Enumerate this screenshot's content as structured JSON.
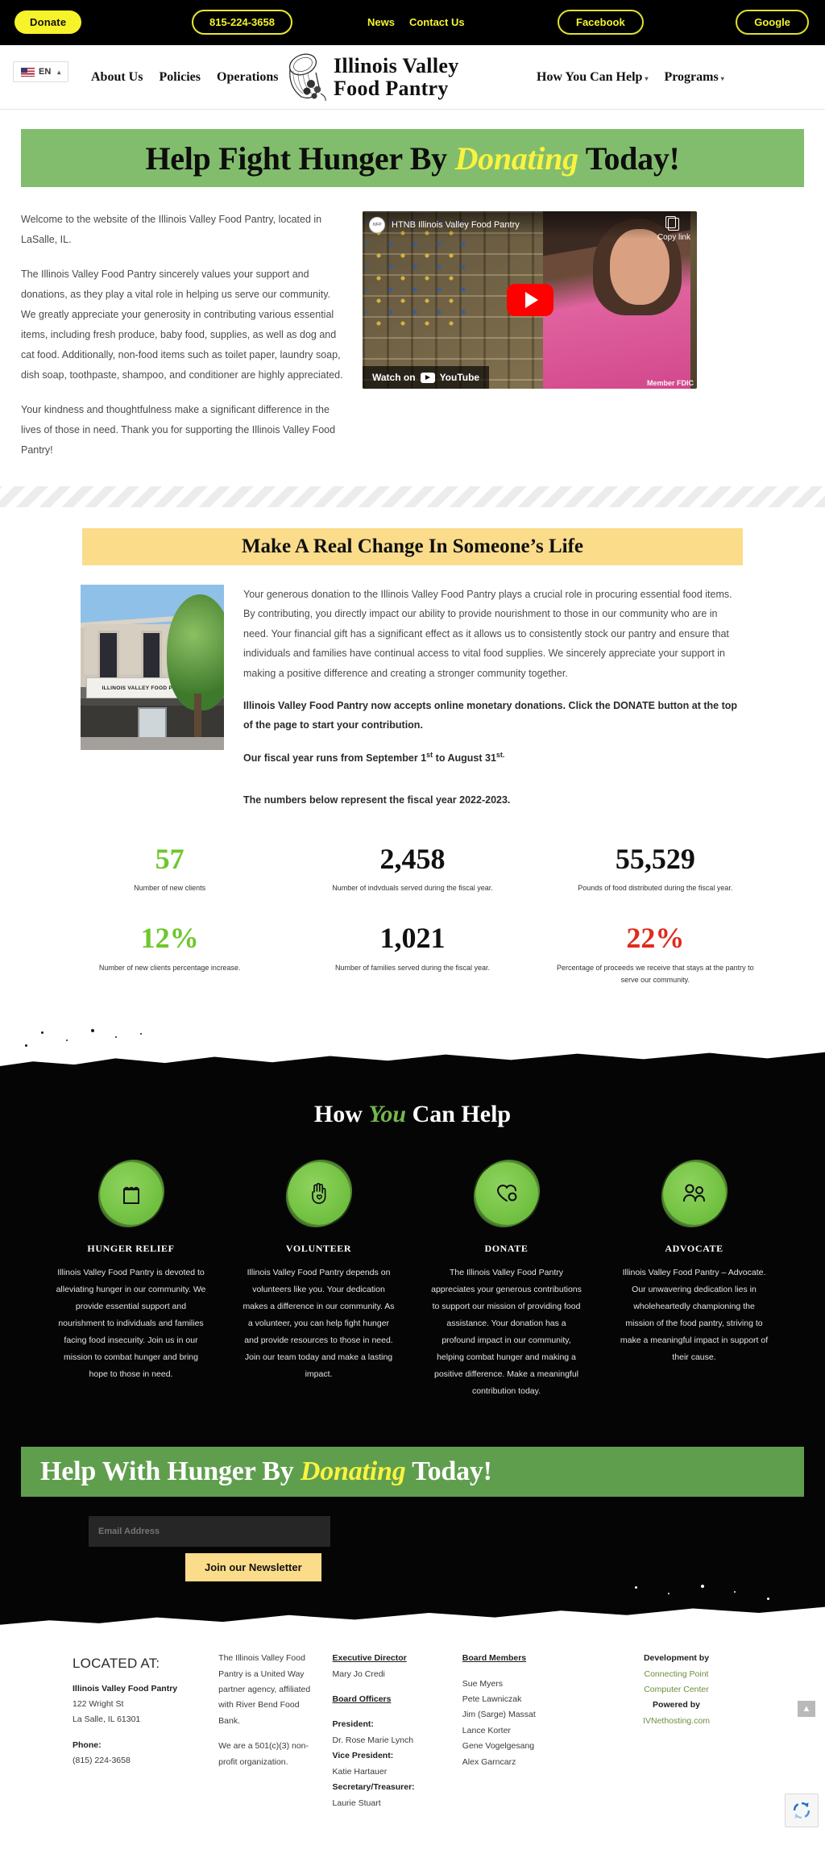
{
  "topbar": {
    "donate_label": "Donate",
    "phone_label": "815-224-3658",
    "news_label": "News",
    "contact_label": "Contact Us",
    "facebook_label": "Facebook",
    "google_label": "Google"
  },
  "nav": {
    "language": "EN",
    "left_items": [
      {
        "label": "About Us"
      },
      {
        "label": "Policies"
      },
      {
        "label": "Operations"
      }
    ],
    "right_items": [
      {
        "label": "How You Can Help",
        "caret": "▾"
      },
      {
        "label": "Programs",
        "caret": "▾"
      }
    ],
    "logo_line1": "Illinois Valley",
    "logo_line2": "Food Pantry"
  },
  "hero": {
    "part1": "Help Fight Hunger ",
    "part2": "By ",
    "accent": "Donating",
    "part3": " Today!"
  },
  "intro": {
    "p1": "Welcome to the website of the Illinois Valley Food Pantry, located in LaSalle, IL.",
    "p2": "The Illinois Valley Food Pantry sincerely values your support and donations, as they play a vital role in helping us serve our community. We greatly appreciate your generosity in contributing various essential items, including fresh produce, baby food, supplies, as well as dog and cat food. Additionally, non-food items such as toilet paper, laundry soap, dish soap, toothpaste, shampoo, and conditioner are highly appreciated.",
    "p3": "Your kindness and thoughtfulness make a significant difference in the lives of those in need. Thank you for supporting the Illinois Valley Food Pantry!"
  },
  "video": {
    "title": "HTNB Illinois Valley Food Pantry",
    "copy_link": "Copy link",
    "watch_on": "Watch on",
    "platform": "YouTube",
    "channel_badge": "IVFP",
    "fdic": "Member FDIC"
  },
  "change": {
    "heading": "Make A Real Change In Someone’s Life",
    "image_sign": "ILLINOIS VALLEY FOOD PANTRY",
    "p1": "Your generous donation to the Illinois Valley Food Pantry plays a crucial role in procuring essential food items. By contributing, you directly impact our ability to provide nourishment to those in our community who are in need. Your financial gift has a significant effect as it allows us to consistently stock our pantry and ensure that individuals and families have continual access to vital food supplies. We sincerely appreciate your support in making a positive difference and creating a stronger community together.",
    "p2": "Illinois Valley Food Pantry now accepts online monetary donations.  Click the DONATE button at the top of the page to start your contribution.",
    "fiscal_a": "Our fiscal year runs from September 1",
    "fiscal_sup1": "st",
    "fiscal_b": " to August 31",
    "fiscal_sup2": "st.",
    "p4": "The numbers below represent the fiscal year 2022-2023."
  },
  "stats": [
    {
      "value": "57",
      "color": "green",
      "caption": "Number of new clients"
    },
    {
      "value": "2,458",
      "color": "black",
      "caption": "Number of indvduals served during the fiscal year."
    },
    {
      "value": "55,529",
      "color": "black",
      "caption": "Pounds of food distributed during the fiscal year."
    },
    {
      "value": "12%",
      "color": "green",
      "caption": "Number of new clients percentage increase."
    },
    {
      "value": "1,021",
      "color": "black",
      "caption": "Number of families served during the fiscal year."
    },
    {
      "value": "22%",
      "color": "red",
      "caption": "Percentage of proceeds we receive that stays at the pantry to serve our community."
    }
  ],
  "help": {
    "title_a": "How ",
    "title_em": "You",
    "title_b": " Can Help",
    "cards": [
      {
        "icon": "grocery-bag-icon",
        "title": "HUNGER RELIEF",
        "text": "Illinois Valley Food Pantry is devoted to alleviating hunger in our community. We provide essential support and nourishment to individuals and families facing food insecurity. Join us in our mission to combat hunger and bring hope to those in need."
      },
      {
        "icon": "helping-hand-icon",
        "title": "VOLUNTEER",
        "text": "Illinois Valley Food Pantry depends on volunteers like you. Your dedication makes a difference in our community. As a volunteer, you can help fight hunger and provide resources to those in need. Join our team today and make a lasting impact."
      },
      {
        "icon": "heart-icon",
        "title": "DONATE",
        "text": "The Illinois Valley Food Pantry appreciates your generous contributions to support our mission of providing food assistance. Your donation has a profound impact in our community, helping combat hunger and making a positive difference.  Make a meaningful contribution today."
      },
      {
        "icon": "people-icon",
        "title": "ADVOCATE",
        "text": "Illinois Valley Food Pantry – Advocate. Our unwavering dedication lies in wholeheartedly championing the mission of the food pantry, striving to make a meaningful impact in support of their cause."
      }
    ]
  },
  "banner2": {
    "part1": "Help With Hunger ",
    "part2": "By ",
    "accent": "Donating",
    "part3": " Today!"
  },
  "newsletter": {
    "email_placeholder": "Email Address",
    "button_label": "Join our Newsletter"
  },
  "footer": {
    "col1": {
      "located_at": "LOCATED AT:",
      "org": "Illinois Valley Food Pantry",
      "street": "122 Wright St",
      "city": "La Salle, IL 61301",
      "phone_label": "Phone:",
      "phone": "(815) 224-3658"
    },
    "col2": {
      "p1": "The Illinois Valley Food Pantry is a United Way partner agency, affiliated with River Bend Food Bank.",
      "p2": "We are a 501(c)(3) non-profit organization."
    },
    "col3": {
      "exec_heading": "Executive Director",
      "exec_name": "Mary Jo Credi",
      "officers_heading": "Board Officers",
      "president_label": "President:",
      "president_name": "Dr. Rose Marie Lynch",
      "vp_label": "Vice President:",
      "vp_name": "Katie Hartauer",
      "sec_label": "Secretary/Treasurer:",
      "sec_name": "Laurie Stuart"
    },
    "col4": {
      "heading": "Board Members",
      "members": [
        "Sue Myers",
        "Pete Lawniczak",
        "Jim (Sarge) Massat",
        "Lance Korter",
        "Gene Vogelgesang",
        "Alex Garncarz"
      ]
    },
    "col5": {
      "dev_by": "Development by",
      "dev_name1": "Connecting Point",
      "dev_name2": "Computer Center",
      "powered_by": "Powered by",
      "host": "IVNethosting.com"
    },
    "to_top": "▲"
  }
}
